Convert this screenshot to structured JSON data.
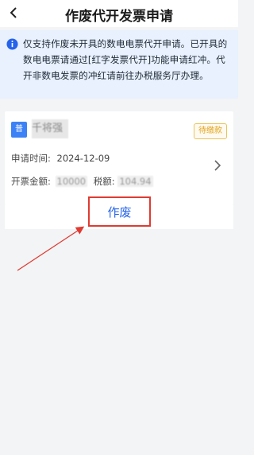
{
  "header": {
    "title": "作废代开发票申请",
    "back_icon": "chevron-left-icon"
  },
  "notice": {
    "icon": "info-icon",
    "text": "仅支持作废未开具的数电电票代开申请。已开具的数电电票请通过[红字发票代开]功能申请红冲。代开非数电发票的冲红请前往办税服务厅办理。"
  },
  "card": {
    "type_label": "普",
    "company_name": "千将强",
    "status": "待缴款",
    "apply_time_label": "申请时间:",
    "apply_time_value": "2024-12-09",
    "invoice_amount_label": "开票金额:",
    "invoice_amount_value": "10000",
    "tax_label": "税额:",
    "tax_value": "104.94",
    "chevron_icon": "chevron-right-icon"
  },
  "action": {
    "void_label": "作废"
  },
  "colors": {
    "accent": "#2563eb",
    "annotation_red": "#df3b32",
    "badge_blue": "#3b82f6",
    "status_orange": "#e2a41c"
  }
}
